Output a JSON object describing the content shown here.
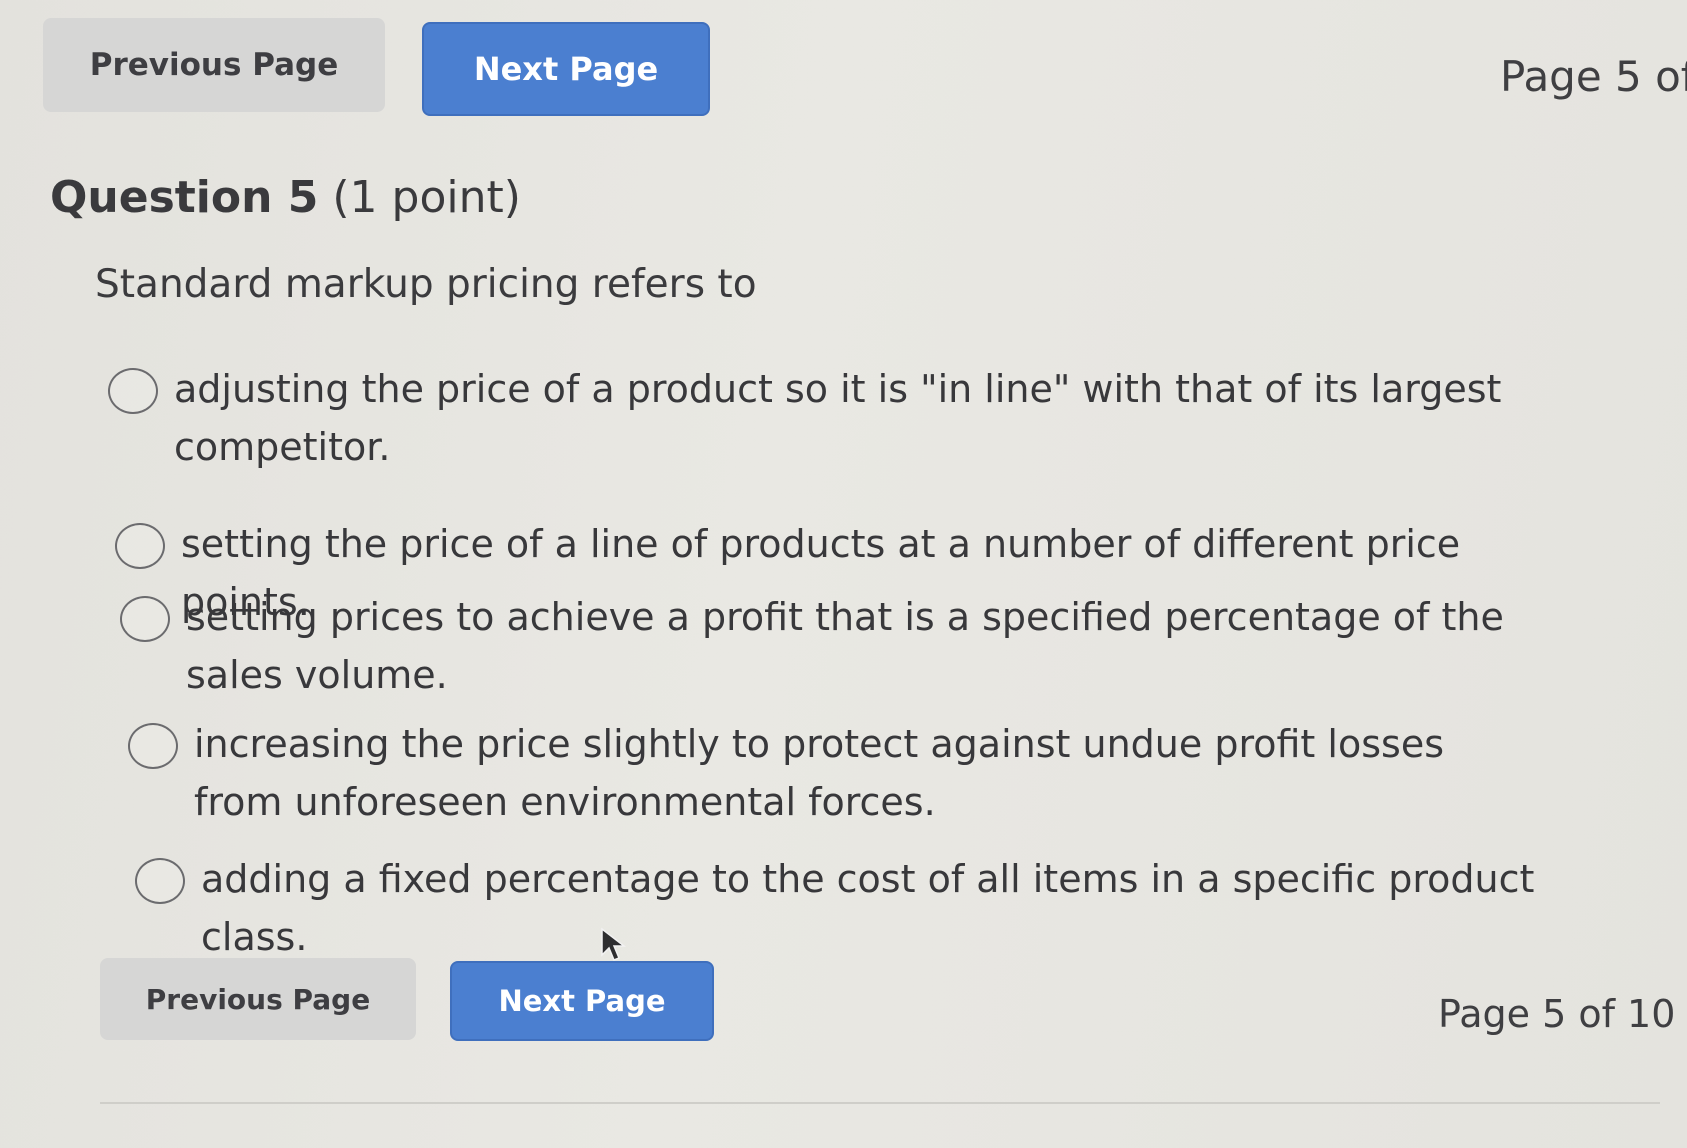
{
  "navigation": {
    "previous_label": "Previous Page",
    "next_label": "Next Page",
    "page_indicator_top": "Page 5 of",
    "page_indicator_bottom": "Page 5 of 10"
  },
  "question": {
    "number_label": "Question 5",
    "points_label": "(1 point)",
    "text": "Standard markup pricing refers to",
    "options": [
      {
        "label": "adjusting the price of a product so it is \"in line\" with that of its largest competitor.",
        "selected": false
      },
      {
        "label": "setting the price of a line of products at a number of different price points.",
        "selected": false
      },
      {
        "label": "setting prices to achieve a profit that is a specified percentage of the sales volume.",
        "selected": false
      },
      {
        "label": "increasing the price slightly to protect against undue profit losses from unforeseen environmental forces.",
        "selected": false
      },
      {
        "label": "adding a fixed percentage to the cost of all items in a specific product class.",
        "selected": false
      }
    ]
  },
  "colors": {
    "primary_button": "#4b7fd0",
    "secondary_button": "#d6d6d5",
    "background": "#e6e5e0"
  }
}
